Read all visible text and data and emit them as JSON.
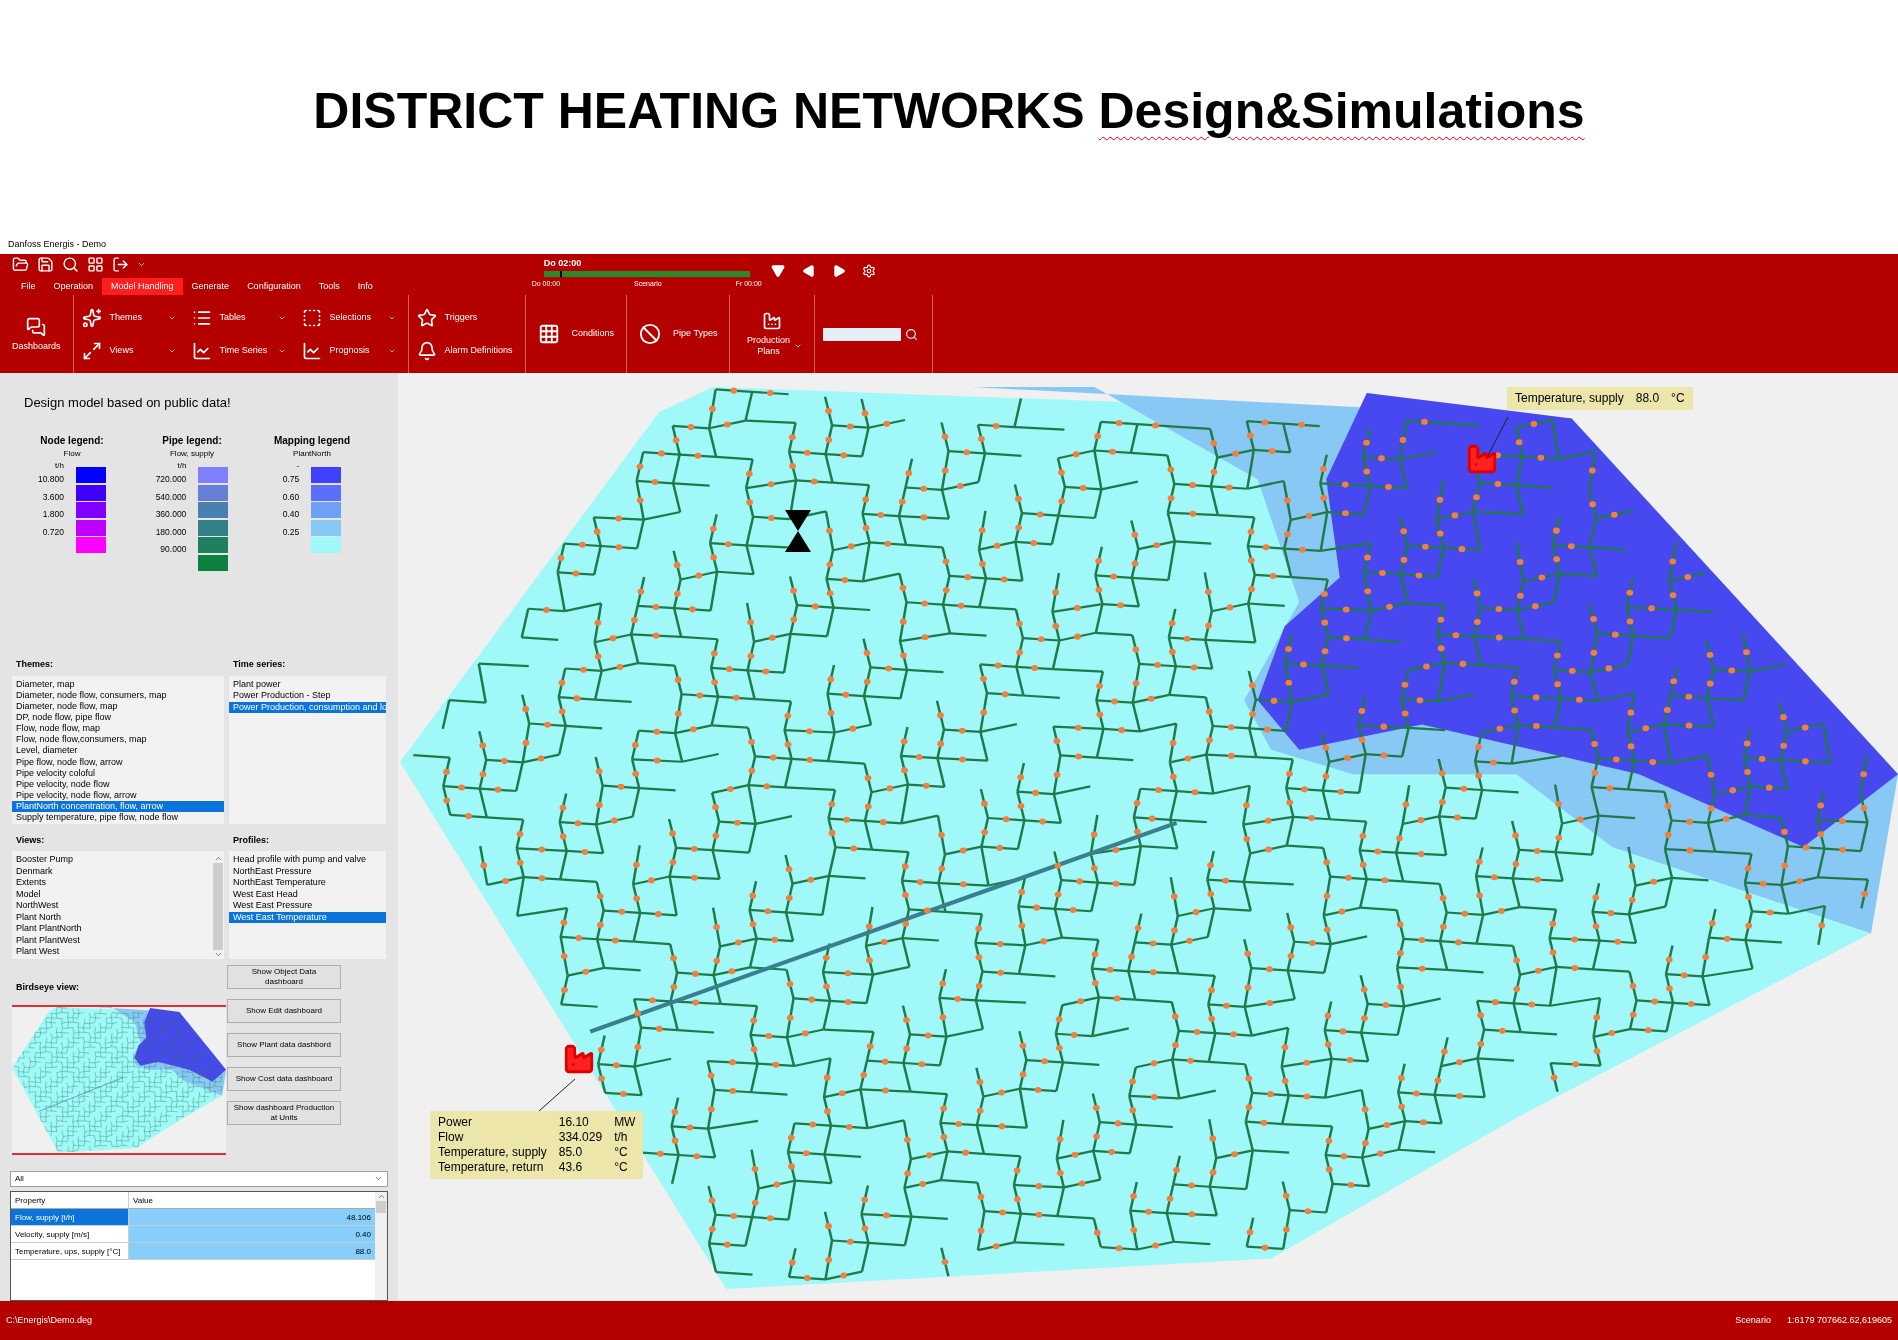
{
  "slide_title": {
    "bold_part": "DISTRICT HEATING NETWORKS",
    "underlined_part": "Design&Simulations"
  },
  "window": {
    "title": "Danfoss Energis - Demo"
  },
  "tabs": [
    {
      "label": "File",
      "selected": false
    },
    {
      "label": "Operation",
      "selected": false
    },
    {
      "label": "Model Handling",
      "selected": true
    },
    {
      "label": "Generate",
      "selected": false
    },
    {
      "label": "Configuration",
      "selected": false
    },
    {
      "label": "Tools",
      "selected": false
    },
    {
      "label": "Info",
      "selected": false
    }
  ],
  "timeline": {
    "current": "Do 02:00",
    "start": "Do 00:00",
    "label": "Scenario",
    "end": "Fr 00:00",
    "level": 0.08
  },
  "ribbon": {
    "groups": [
      {
        "kind": "large",
        "items": [
          {
            "label": "Dashboards",
            "dropdown": false
          }
        ]
      },
      {
        "kind": "small",
        "items": [
          {
            "label": "Themes",
            "dropdown": true
          },
          {
            "label": "Views",
            "dropdown": true
          },
          {
            "label": "Tables",
            "dropdown": true
          },
          {
            "label": "Time Series",
            "dropdown": true
          },
          {
            "label": "Selections",
            "dropdown": true
          },
          {
            "label": "Prognosis",
            "dropdown": true
          }
        ]
      },
      {
        "kind": "small",
        "items": [
          {
            "label": "Triggers",
            "dropdown": false
          },
          {
            "label": "Alarm Definitions",
            "dropdown": false
          }
        ]
      },
      {
        "kind": "inline",
        "items": [
          {
            "label": "Conditions",
            "dropdown": false
          }
        ]
      },
      {
        "kind": "inline",
        "items": [
          {
            "label": "Pipe Types",
            "dropdown": false
          }
        ]
      },
      {
        "kind": "large",
        "items": [
          {
            "label": "Production Plans",
            "dropdown": true
          }
        ]
      },
      {
        "kind": "search"
      }
    ]
  },
  "left_panel": {
    "heading": "Design model based on public data!",
    "legends": [
      {
        "title": "Node legend:",
        "quantity": "Flow",
        "unit": "t/h",
        "swatches": [
          {
            "color": "#0000ff"
          },
          {
            "color": "#4000ff"
          },
          {
            "color": "#8000ff"
          },
          {
            "color": "#c000ff"
          },
          {
            "color": "#ff00ff"
          }
        ],
        "labels": [
          "10.800",
          "3.600",
          "1.800",
          "0.720"
        ]
      },
      {
        "title": "Pipe legend:",
        "quantity": "Flow, supply",
        "unit": "t/h",
        "swatches": [
          {
            "color": "#8080ff"
          },
          {
            "color": "#6680d8"
          },
          {
            "color": "#4a80b0"
          },
          {
            "color": "#338088"
          },
          {
            "color": "#1f8060"
          },
          {
            "color": "#0b8040"
          }
        ],
        "labels": [
          "720.000",
          "540.000",
          "360.000",
          "180.000",
          "90.000"
        ]
      },
      {
        "title": "Mapping legend",
        "quantity": "PlantNorth",
        "unit": "-",
        "swatches": [
          {
            "color": "#4040ff"
          },
          {
            "color": "#5a70fa"
          },
          {
            "color": "#70a0f5"
          },
          {
            "color": "#88c8f5"
          },
          {
            "color": "#a0f8f8"
          }
        ],
        "labels": [
          "0.75",
          "0.60",
          "0.40",
          "0.25"
        ]
      }
    ],
    "themes": {
      "label": "Themes:",
      "items": [
        {
          "text": "Diameter, map",
          "selected": false
        },
        {
          "text": "Diameter, node flow, consumers, map",
          "selected": false
        },
        {
          "text": "Diameter, node flow, map",
          "selected": false
        },
        {
          "text": "DP, node flow, pipe flow",
          "selected": false
        },
        {
          "text": "Flow, node flow, map",
          "selected": false
        },
        {
          "text": "Flow, node flow,consumers, map",
          "selected": false
        },
        {
          "text": "Level, diameter",
          "selected": false
        },
        {
          "text": "Pipe flow, node flow, arrow",
          "selected": false
        },
        {
          "text": "Pipe velocity coloful",
          "selected": false
        },
        {
          "text": "Pipe velocity, node flow",
          "selected": false
        },
        {
          "text": "Pipe velocity, node flow, arrow",
          "selected": false
        },
        {
          "text": "PlantNorth concentration, flow, arrow",
          "selected": true
        },
        {
          "text": "Supply temperature, pipe flow, node flow",
          "selected": false
        }
      ]
    },
    "time_series": {
      "label": "Time series:",
      "items": [
        {
          "text": "Plant power",
          "selected": false
        },
        {
          "text": "Power Production - Step",
          "selected": false
        },
        {
          "text": "Power Production, consumption and lo",
          "selected": true
        }
      ]
    },
    "views": {
      "label": "Views:",
      "items": [
        {
          "text": "Booster Pump",
          "selected": false
        },
        {
          "text": "Denmark",
          "selected": false
        },
        {
          "text": "Extents",
          "selected": false
        },
        {
          "text": "Model",
          "selected": false
        },
        {
          "text": "NorthWest",
          "selected": false
        },
        {
          "text": "Plant North",
          "selected": false
        },
        {
          "text": "Plant PlantNorth",
          "selected": false
        },
        {
          "text": "Plant PlantWest",
          "selected": false
        },
        {
          "text": "Plant West",
          "selected": false
        }
      ]
    },
    "profiles": {
      "label": "Profiles:",
      "items": [
        {
          "text": "Head profile with pump and valve",
          "selected": false
        },
        {
          "text": "NorthEast Pressure",
          "selected": false
        },
        {
          "text": "NorthEast Temperature",
          "selected": false
        },
        {
          "text": "West East Head",
          "selected": false
        },
        {
          "text": "West East Pressure",
          "selected": false
        },
        {
          "text": "West East Temperature",
          "selected": true
        }
      ]
    },
    "birdseye_label": "Birdseye view:",
    "buttons": [
      "Show Object Data dashboard",
      "Show Edit dashboard",
      "Show Plant data dashbord",
      "Show Cost data dashboard",
      "Show dashboard Production at Units"
    ],
    "filter": {
      "value": "All"
    },
    "properties": {
      "columns": [
        "Property",
        "Value"
      ],
      "rows": [
        {
          "property": "Flow, supply [t/h]",
          "value": "48.106",
          "selected": true
        },
        {
          "property": "Velocity, supply [m/s]",
          "value": "0.40",
          "selected": false
        },
        {
          "property": "Temperature, ups, supply [°C]",
          "value": "88.0",
          "selected": false
        }
      ]
    }
  },
  "map": {
    "popups": [
      {
        "rows": [
          {
            "label": "Temperature, supply",
            "value": "88.0",
            "unit": "°C"
          }
        ]
      },
      {
        "rows": [
          {
            "label": "Power",
            "value": "16.10",
            "unit": "MW"
          },
          {
            "label": "Flow",
            "value": "334.029",
            "unit": "t/h"
          },
          {
            "label": "Temperature, supply",
            "value": "85.0",
            "unit": "°C"
          },
          {
            "label": "Temperature, return",
            "value": "43.6",
            "unit": "°C"
          }
        ]
      }
    ]
  },
  "status_bar": {
    "path": "C:\\Energis\\Demo.deg",
    "mode": "Scenario",
    "coordinates": "1:6179 707662.62,619605"
  }
}
